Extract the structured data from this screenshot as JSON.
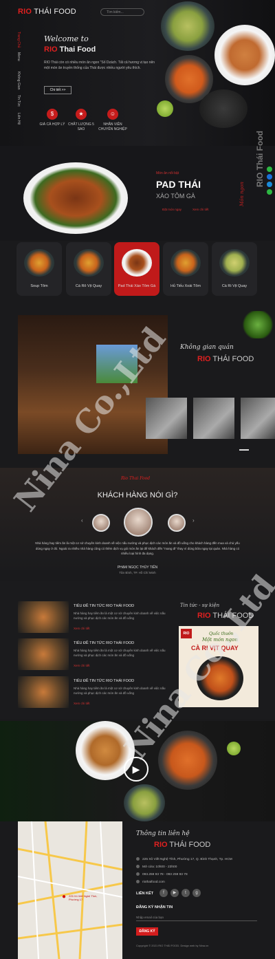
{
  "header": {
    "logo_red": "RIO",
    "logo_rest": " THÁI FOOD",
    "search_placeholder": "Tìm kiếm...",
    "menu": [
      "Trang Chủ",
      "Menu",
      "Không Gian",
      "Tin Tức",
      "Liên Hệ"
    ]
  },
  "hero": {
    "welcome": "Welcome to",
    "title_red": "RIO",
    "title_rest": " Thai Food",
    "description": "RIO Thái còn có nhiều món ăn ngon \"Số Dzách. Tất cả hương vị tạo nên một món ăn truyền thống của Thái được nhiều người yêu thích.",
    "button": "Chi tiết >>",
    "features": [
      "GIÁ CẢ HỢP LÝ",
      "CHẤT LƯỢNG 5 SAO",
      "NHÂN VIÊN CHUYÊN NGHIỆP"
    ]
  },
  "featured": {
    "subtitle": "Món ăn nổi bật",
    "title": "PAD THÁI",
    "subtitle2": "XÀO TÔM GÀ",
    "link1": "Đặt món ngay",
    "link2": "Xem chi tiết",
    "side_script": "Món ngon",
    "side_brand": "RIO Thái Food"
  },
  "categories": [
    "Soup Tôm",
    "Cá Rô Vịt Quay",
    "Pad Thái Xào Tôm Gà",
    "Hủ Tiếu Xoài Tôm",
    "Cà Ri Vịt Quay"
  ],
  "space": {
    "script": "Không gian quán",
    "brand_red": "RIO",
    "brand_rest": " THÁI FOOD"
  },
  "reviews": {
    "script": "Rio Thai Food",
    "title": "KHÁCH HÀNG NÓI GÌ?",
    "text": "Nhà hàng hay tiêm ăn là một cơ sở chuyên kinh doanh về việc nấu nướng và phục dịch các món ăn và đồ uống cho khách hàng đến mua và chủ yếu dùng ngay ở đó. Ngoài ra nhiều nhà hàng cũng có thêm dịch vụ gói món ăn lại để khách đến \"mang đi\" thay vì dùng bữa ngay tại quán. Nhà hàng có nhiều loại hình đa dạng.",
    "name": "PHẠM NGỌC THÚY TIÊN",
    "place": "Tân Bình, TP. Hồ Chí Minh"
  },
  "news": {
    "script": "Tin tức - sự kiện",
    "brand_red": "RIO",
    "brand_rest": " THÁI FOOD",
    "items": [
      {
        "title": "TIÊU ĐỀ TIN TỨC RIO THÁI FOOD",
        "desc": "Nhà hàng hay tiêm ăn là một cơ sở chuyên kinh doanh về việc nấu nướng và phục dịch các món ăn và đồ uống",
        "more": "Xem chi tiết"
      },
      {
        "title": "TIÊU ĐỀ TIN TỨC RIO THÁI FOOD",
        "desc": "Nhà hàng hay tiêm ăn là một cơ sở chuyên kinh doanh về việc nấu nướng và phục dịch các món ăn và đồ uống",
        "more": "Xem chi tiết"
      },
      {
        "title": "TIÊU ĐỀ TIN TỨC RIO THÁI FOOD",
        "desc": "Nhà hàng hay tiêm ăn là một cơ sở chuyên kinh doanh về việc nấu nướng và phục dịch các món ăn và đồ uống",
        "more": "Xem chi tiết"
      }
    ],
    "poster_line1": "Quốc thưởn",
    "poster_line2": "Một món ngon",
    "poster_line3": "CÀ RI VỊT QUAY",
    "poster_logo": "RIO"
  },
  "contact": {
    "script": "Thông tin liên hệ",
    "brand_red": "RIO",
    "brand_rest": " THÁI FOOD",
    "address": "225 Xô Viết Nghệ Tĩnh, Phường 17, Q. Bình Thạnh, Tp. HCM",
    "hours": "Mở cửa: 10h00 - 23h00",
    "phone": "093.259 93 78 - 093 259 93 78",
    "email": "riothaifood.com",
    "links_label": "LIÊN KẾT",
    "newsletter_label": "ĐĂNG KÝ NHẬN TIN",
    "newsletter_placeholder": "Nhập email của bạn",
    "newsletter_button": "ĐĂNG KÝ",
    "copyright": "Copyright © 2021 RIO THÁI FOOD. Design web by Nina.vn"
  },
  "map": {
    "pin_label": "225 Xô Viết Nghệ Tĩnh, Phường 17"
  },
  "watermark": "Nina Co.,Ltd"
}
